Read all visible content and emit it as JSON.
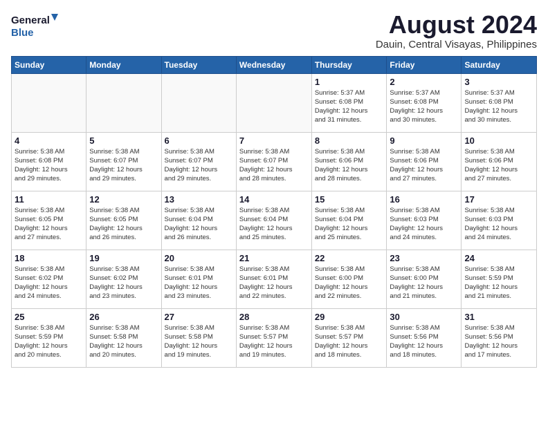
{
  "header": {
    "logo_line1": "General",
    "logo_line2": "Blue",
    "month_year": "August 2024",
    "location": "Dauin, Central Visayas, Philippines"
  },
  "weekdays": [
    "Sunday",
    "Monday",
    "Tuesday",
    "Wednesday",
    "Thursday",
    "Friday",
    "Saturday"
  ],
  "weeks": [
    [
      {
        "day": "",
        "info": ""
      },
      {
        "day": "",
        "info": ""
      },
      {
        "day": "",
        "info": ""
      },
      {
        "day": "",
        "info": ""
      },
      {
        "day": "1",
        "info": "Sunrise: 5:37 AM\nSunset: 6:08 PM\nDaylight: 12 hours\nand 31 minutes."
      },
      {
        "day": "2",
        "info": "Sunrise: 5:37 AM\nSunset: 6:08 PM\nDaylight: 12 hours\nand 30 minutes."
      },
      {
        "day": "3",
        "info": "Sunrise: 5:37 AM\nSunset: 6:08 PM\nDaylight: 12 hours\nand 30 minutes."
      }
    ],
    [
      {
        "day": "4",
        "info": "Sunrise: 5:38 AM\nSunset: 6:08 PM\nDaylight: 12 hours\nand 29 minutes."
      },
      {
        "day": "5",
        "info": "Sunrise: 5:38 AM\nSunset: 6:07 PM\nDaylight: 12 hours\nand 29 minutes."
      },
      {
        "day": "6",
        "info": "Sunrise: 5:38 AM\nSunset: 6:07 PM\nDaylight: 12 hours\nand 29 minutes."
      },
      {
        "day": "7",
        "info": "Sunrise: 5:38 AM\nSunset: 6:07 PM\nDaylight: 12 hours\nand 28 minutes."
      },
      {
        "day": "8",
        "info": "Sunrise: 5:38 AM\nSunset: 6:06 PM\nDaylight: 12 hours\nand 28 minutes."
      },
      {
        "day": "9",
        "info": "Sunrise: 5:38 AM\nSunset: 6:06 PM\nDaylight: 12 hours\nand 27 minutes."
      },
      {
        "day": "10",
        "info": "Sunrise: 5:38 AM\nSunset: 6:06 PM\nDaylight: 12 hours\nand 27 minutes."
      }
    ],
    [
      {
        "day": "11",
        "info": "Sunrise: 5:38 AM\nSunset: 6:05 PM\nDaylight: 12 hours\nand 27 minutes."
      },
      {
        "day": "12",
        "info": "Sunrise: 5:38 AM\nSunset: 6:05 PM\nDaylight: 12 hours\nand 26 minutes."
      },
      {
        "day": "13",
        "info": "Sunrise: 5:38 AM\nSunset: 6:04 PM\nDaylight: 12 hours\nand 26 minutes."
      },
      {
        "day": "14",
        "info": "Sunrise: 5:38 AM\nSunset: 6:04 PM\nDaylight: 12 hours\nand 25 minutes."
      },
      {
        "day": "15",
        "info": "Sunrise: 5:38 AM\nSunset: 6:04 PM\nDaylight: 12 hours\nand 25 minutes."
      },
      {
        "day": "16",
        "info": "Sunrise: 5:38 AM\nSunset: 6:03 PM\nDaylight: 12 hours\nand 24 minutes."
      },
      {
        "day": "17",
        "info": "Sunrise: 5:38 AM\nSunset: 6:03 PM\nDaylight: 12 hours\nand 24 minutes."
      }
    ],
    [
      {
        "day": "18",
        "info": "Sunrise: 5:38 AM\nSunset: 6:02 PM\nDaylight: 12 hours\nand 24 minutes."
      },
      {
        "day": "19",
        "info": "Sunrise: 5:38 AM\nSunset: 6:02 PM\nDaylight: 12 hours\nand 23 minutes."
      },
      {
        "day": "20",
        "info": "Sunrise: 5:38 AM\nSunset: 6:01 PM\nDaylight: 12 hours\nand 23 minutes."
      },
      {
        "day": "21",
        "info": "Sunrise: 5:38 AM\nSunset: 6:01 PM\nDaylight: 12 hours\nand 22 minutes."
      },
      {
        "day": "22",
        "info": "Sunrise: 5:38 AM\nSunset: 6:00 PM\nDaylight: 12 hours\nand 22 minutes."
      },
      {
        "day": "23",
        "info": "Sunrise: 5:38 AM\nSunset: 6:00 PM\nDaylight: 12 hours\nand 21 minutes."
      },
      {
        "day": "24",
        "info": "Sunrise: 5:38 AM\nSunset: 5:59 PM\nDaylight: 12 hours\nand 21 minutes."
      }
    ],
    [
      {
        "day": "25",
        "info": "Sunrise: 5:38 AM\nSunset: 5:59 PM\nDaylight: 12 hours\nand 20 minutes."
      },
      {
        "day": "26",
        "info": "Sunrise: 5:38 AM\nSunset: 5:58 PM\nDaylight: 12 hours\nand 20 minutes."
      },
      {
        "day": "27",
        "info": "Sunrise: 5:38 AM\nSunset: 5:58 PM\nDaylight: 12 hours\nand 19 minutes."
      },
      {
        "day": "28",
        "info": "Sunrise: 5:38 AM\nSunset: 5:57 PM\nDaylight: 12 hours\nand 19 minutes."
      },
      {
        "day": "29",
        "info": "Sunrise: 5:38 AM\nSunset: 5:57 PM\nDaylight: 12 hours\nand 18 minutes."
      },
      {
        "day": "30",
        "info": "Sunrise: 5:38 AM\nSunset: 5:56 PM\nDaylight: 12 hours\nand 18 minutes."
      },
      {
        "day": "31",
        "info": "Sunrise: 5:38 AM\nSunset: 5:56 PM\nDaylight: 12 hours\nand 17 minutes."
      }
    ]
  ]
}
